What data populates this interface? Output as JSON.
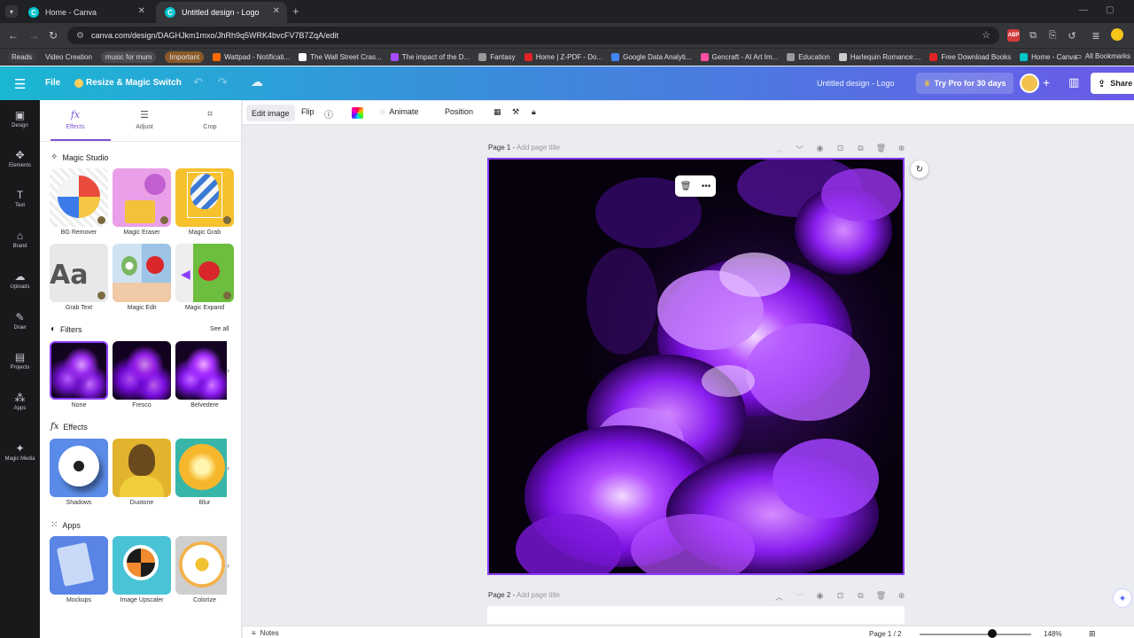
{
  "browser": {
    "tabs": [
      {
        "title": "Home - Canva",
        "active": false
      },
      {
        "title": "Untitled design - Logo",
        "active": true
      }
    ],
    "url": "canva.com/design/DAGHJkm1mxo/JhRh9q5WRK4bvcFV7B7ZqA/edit",
    "bookmarks": [
      {
        "label": "Reads",
        "pill": true,
        "color": "#3c3c41"
      },
      {
        "label": "Video Creation",
        "pill": false,
        "color": ""
      },
      {
        "label": "music for mum",
        "pill": true,
        "color": "#4a4a4f"
      },
      {
        "label": "Important",
        "pill": true,
        "color": "#8a5a2a"
      },
      {
        "label": "Wattpad - Notificati...",
        "pill": false,
        "color": "#ff6a00"
      },
      {
        "label": "The Wall Street Cras...",
        "pill": false,
        "color": "#ffffff"
      },
      {
        "label": "The impact of the D...",
        "pill": false,
        "color": "#a64dff"
      },
      {
        "label": "Fantasy",
        "pill": false,
        "color": "#999999"
      },
      {
        "label": "Home | Z-PDF - Do...",
        "pill": false,
        "color": "#e02424"
      },
      {
        "label": "Google Data Analyti...",
        "pill": false,
        "color": "#4285f4"
      },
      {
        "label": "Gencraft - AI Art Im...",
        "pill": false,
        "color": "#ff4fa3"
      },
      {
        "label": "Education",
        "pill": false,
        "color": "#999999"
      },
      {
        "label": "Harlequin Romance:...",
        "pill": false,
        "color": "#cccccc"
      },
      {
        "label": "Free Download Books",
        "pill": false,
        "color": "#e02424"
      },
      {
        "label": "Home - Canva",
        "pill": false,
        "color": "#00c4cc"
      }
    ],
    "all_bookmarks": "All Bookmarks"
  },
  "header": {
    "file": "File",
    "resize": "Resize & Magic Switch",
    "design_title": "Untitled design - Logo",
    "try_pro": "Try Pro for 30 days",
    "share": "Share"
  },
  "rail": [
    {
      "label": "Design",
      "icon": "▣"
    },
    {
      "label": "Elements",
      "icon": "✥"
    },
    {
      "label": "Text",
      "icon": "T"
    },
    {
      "label": "Brand",
      "icon": "⌂"
    },
    {
      "label": "Uploads",
      "icon": "☁"
    },
    {
      "label": "Draw",
      "icon": "✎"
    },
    {
      "label": "Projects",
      "icon": "▤"
    },
    {
      "label": "Apps",
      "icon": "⁂"
    },
    {
      "label": "Magic Media",
      "icon": "✦"
    }
  ],
  "panel": {
    "tabs": {
      "effects": "Effects",
      "adjust": "Adjust",
      "crop": "Crop"
    },
    "magic_studio": {
      "title": "Magic Studio",
      "tools": [
        "BG Remover",
        "Magic Eraser",
        "Magic Grab",
        "Grab Text",
        "Magic Edit",
        "Magic Expand"
      ]
    },
    "filters": {
      "title": "Filters",
      "see_all": "See all",
      "items": [
        "None",
        "Fresco",
        "Belvedere"
      ]
    },
    "effects": {
      "title": "Effects",
      "items": [
        "Shadows",
        "Duotone",
        "Blur"
      ]
    },
    "apps": {
      "title": "Apps",
      "items": [
        "Mockups",
        "Image Upscaler",
        "Colorize"
      ]
    }
  },
  "toolbar": {
    "edit_image": "Edit image",
    "flip": "Flip",
    "animate": "Animate",
    "position": "Position"
  },
  "canvas": {
    "page1_label": "Page 1 -",
    "page1_placeholder": "Add page title",
    "page2_label": "Page 2 -",
    "page2_placeholder": "Add page title",
    "selection_color": "#8b3dff"
  },
  "bottom": {
    "notes": "Notes",
    "page_indicator": "Page 1 / 2",
    "zoom": "148%",
    "zoom_fraction": 0.65
  }
}
